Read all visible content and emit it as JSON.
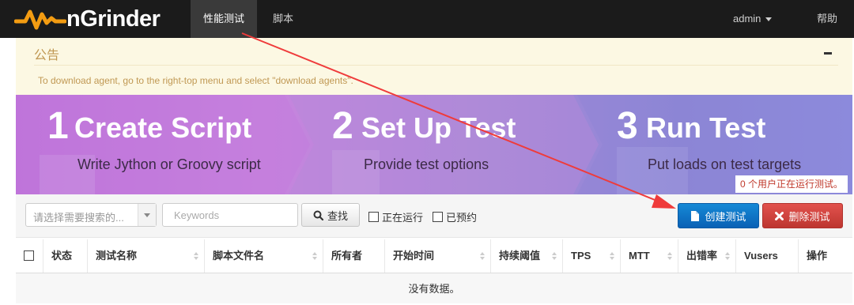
{
  "app": {
    "brand": "nGrinder"
  },
  "nav": {
    "tabs": [
      {
        "label": "性能测试",
        "active": true
      },
      {
        "label": "脚本",
        "active": false
      }
    ],
    "user": "admin",
    "help": "帮助"
  },
  "notice": {
    "title": "公告",
    "body": "To download agent, go to the right-top menu and select \"download agents\"."
  },
  "banner": {
    "steps": [
      {
        "number": "1",
        "title": "Create Script",
        "subtitle": "Write Jython or Groovy script"
      },
      {
        "number": "2",
        "title": "Set Up Test",
        "subtitle": "Provide test options"
      },
      {
        "number": "3",
        "title": "Run Test",
        "subtitle": "Put loads on test targets"
      }
    ],
    "user_status": "0 个用户正在运行测试。"
  },
  "toolbar": {
    "select_placeholder": "请选择需要搜索的...",
    "keyword_placeholder": "Keywords",
    "find_label": "查找",
    "running_label": "正在运行",
    "scheduled_label": "已预约",
    "create_label": "创建测试",
    "delete_label": "删除测试"
  },
  "table": {
    "columns": [
      "状态",
      "测试名称",
      "脚本文件名",
      "所有者",
      "开始时间",
      "持续阈值",
      "TPS",
      "MTT",
      "出错率",
      "Vusers",
      "操作"
    ],
    "empty_text": "没有数据。"
  },
  "colors": {
    "accent_orange": "#f39c12",
    "create_blue": "#0a61b5",
    "delete_red": "#bd3630",
    "annotation_red": "#ef3b3b"
  }
}
